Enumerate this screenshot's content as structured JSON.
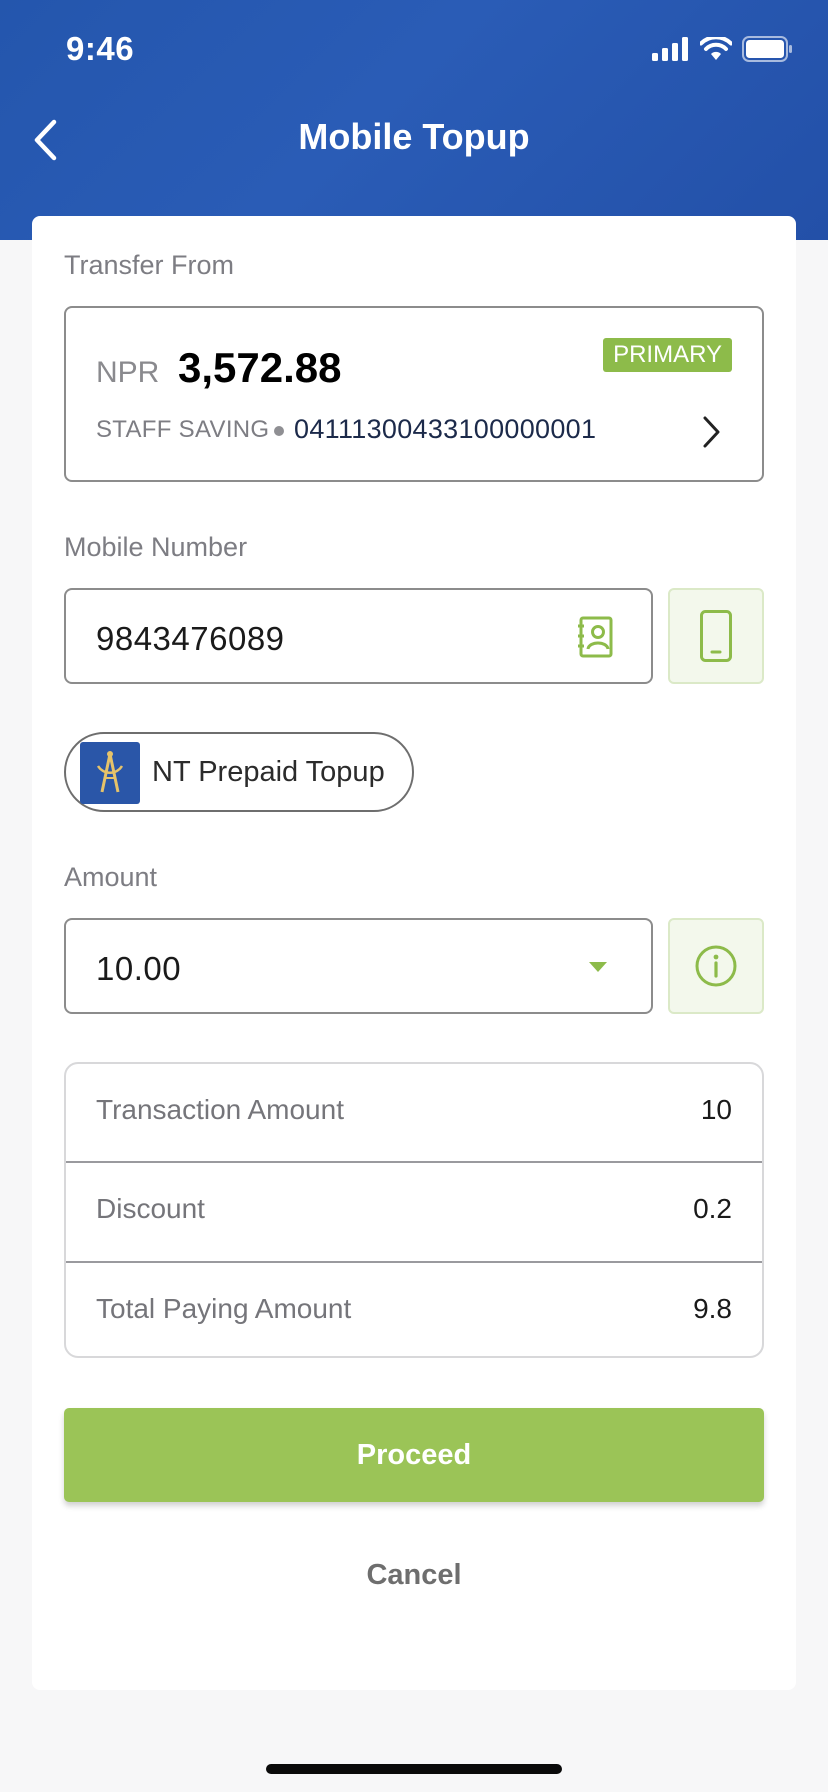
{
  "status_bar": {
    "time": "9:46"
  },
  "header": {
    "title": "Mobile Topup"
  },
  "transfer_from": {
    "label": "Transfer From",
    "currency": "NPR",
    "balance": "3,572.88",
    "badge": "PRIMARY",
    "account_type": "STAFF SAVING",
    "account_number": "04111300433100000001"
  },
  "mobile": {
    "label": "Mobile Number",
    "value": "9843476089"
  },
  "operator": {
    "name": "NT Prepaid Topup"
  },
  "amount": {
    "label": "Amount",
    "value": "10.00"
  },
  "summary": [
    {
      "label": "Transaction Amount",
      "value": "10"
    },
    {
      "label": "Discount",
      "value": "0.2"
    },
    {
      "label": "Total Paying Amount",
      "value": "9.8"
    }
  ],
  "actions": {
    "proceed": "Proceed",
    "cancel": "Cancel"
  },
  "colors": {
    "header": "#2456ad",
    "accent": "#9bc457"
  },
  "icons": {
    "back": "chevron-left-icon",
    "account": "chevron-right-icon",
    "contacts": "contact-book-icon",
    "device": "mobile-phone-icon",
    "amount_info": "info-icon",
    "operator_logo": "nepal-telecom-logo"
  }
}
